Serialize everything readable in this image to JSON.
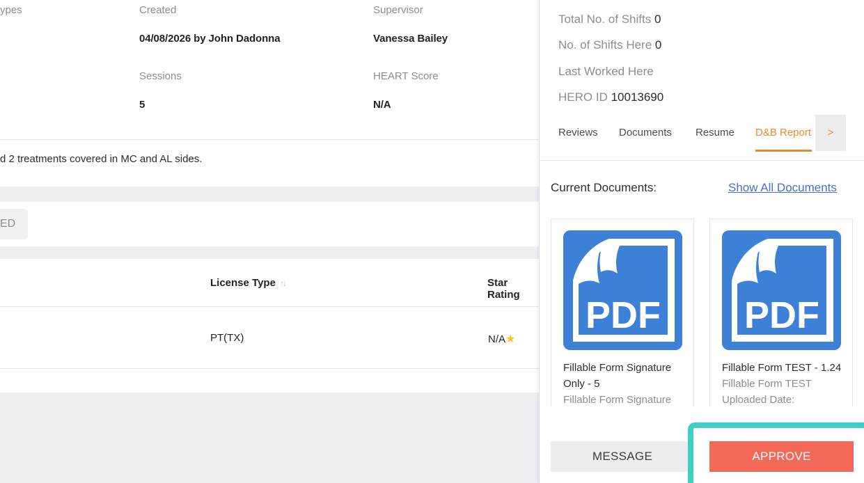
{
  "profile": {
    "types_label_partial": "ypes",
    "created_label": "Created",
    "created_value": "04/08/2026 by John Dadonna",
    "supervisor_label": "Supervisor",
    "supervisor_value": "Vanessa Bailey",
    "sessions_label": "Sessions",
    "sessions_value": "5",
    "heart_label": "HEART Score",
    "heart_value": "N/A",
    "note_partial": "d 2 treatments covered in MC and AL sides."
  },
  "filter": {
    "button_partial": "ED"
  },
  "table": {
    "columns": [
      "License Type",
      "Star Rating"
    ],
    "sort_icon": "sort-icon",
    "rows": [
      {
        "license_type": "PT(TX)",
        "star_rating": "N/A",
        "star_icon": "star-icon"
      }
    ]
  },
  "panel": {
    "stats": [
      {
        "label": "Total No. of Shifts",
        "value": "0"
      },
      {
        "label": "No. of Shifts Here",
        "value": "0"
      },
      {
        "label": "Last Worked Here",
        "value": ""
      },
      {
        "label": "HERO ID",
        "value": "10013690"
      }
    ],
    "tabs": [
      "Reviews",
      "Documents",
      "Resume",
      "D&B Report"
    ],
    "active_tab": "D&B Report",
    "tab_next": ">",
    "current_documents_label": "Current Documents:",
    "show_all_label": "Show All Documents",
    "documents": [
      {
        "title": "Fillable Form Signature Only - 5",
        "subtitle": "Fillable Form Signature",
        "icon": "pdf-icon"
      },
      {
        "title": "Fillable Form TEST - 1.24",
        "subtitle": "Fillable Form TEST",
        "extra": "Uploaded Date:",
        "icon": "pdf-icon"
      }
    ],
    "message_label": "MESSAGE",
    "approve_label": "APPROVE",
    "colors": {
      "accent": "#e8892d",
      "approve": "#f2695a",
      "highlight": "#3ecfc6",
      "pdf_blue": "#3d7fd6"
    }
  }
}
